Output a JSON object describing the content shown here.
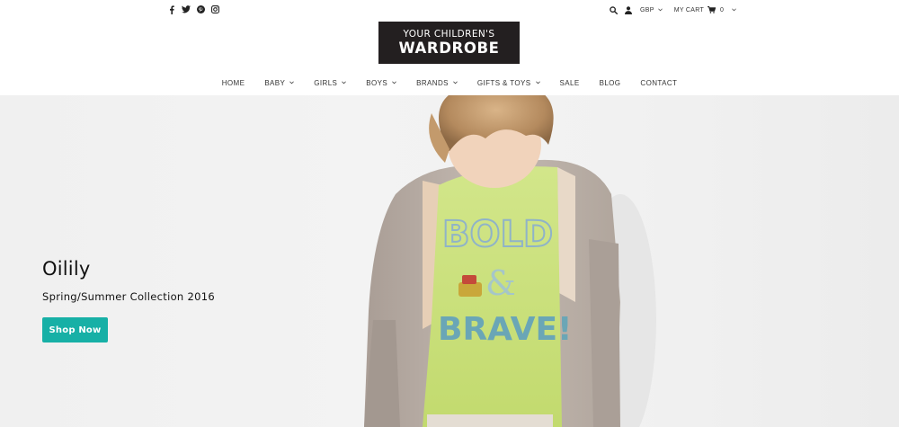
{
  "header": {
    "social": [
      {
        "icon": "facebook-icon"
      },
      {
        "icon": "twitter-icon"
      },
      {
        "icon": "pinterest-icon"
      },
      {
        "icon": "instagram-icon"
      }
    ],
    "utility": {
      "currency": "GBP",
      "cart_label": "MY CART",
      "cart_count": "0"
    },
    "logo": {
      "line1": "YOUR CHILDREN'S",
      "line2": "WARDROBE"
    },
    "nav": [
      {
        "label": "HOME",
        "has_dropdown": false
      },
      {
        "label": "BABY",
        "has_dropdown": true
      },
      {
        "label": "GIRLS",
        "has_dropdown": true
      },
      {
        "label": "BOYS",
        "has_dropdown": true
      },
      {
        "label": "BRANDS",
        "has_dropdown": true
      },
      {
        "label": "GIFTS & TOYS",
        "has_dropdown": true
      },
      {
        "label": "SALE",
        "has_dropdown": false
      },
      {
        "label": "BLOG",
        "has_dropdown": false
      },
      {
        "label": "CONTACT",
        "has_dropdown": false
      }
    ]
  },
  "hero": {
    "title": "Oilily",
    "subtitle": "Spring/Summer Collection 2016",
    "button_label": "Shop Now",
    "shirt_text": {
      "top": "BOLD",
      "middle": "&",
      "bottom": "BRAVE!"
    }
  },
  "colors": {
    "accent": "#17b0a6",
    "logo_bg": "#231f20",
    "hero_bg": "#f2f2f2",
    "shirt": "#c8e07a",
    "hoodie": "#b8ada5"
  }
}
